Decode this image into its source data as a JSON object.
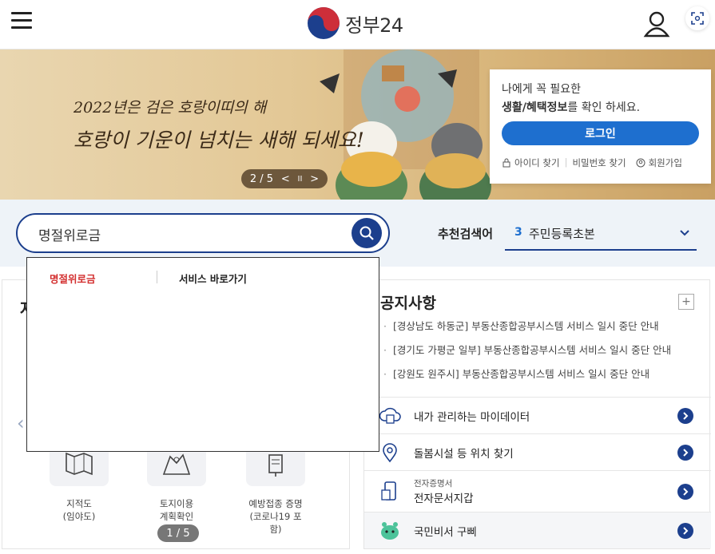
{
  "header": {
    "logo_text": "정부24"
  },
  "banner": {
    "line1": "2022년은 검은 호랑이띠의 해",
    "line2": "호랑이 기운이 넘치는 새해 되세요!",
    "slide_counter": "2 / 5",
    "prev": "<",
    "pause": "II",
    "next": ">"
  },
  "login_card": {
    "message_line1": "나에게 꼭 필요한",
    "message_bold": "생활/혜택정보",
    "message_rest": "를 확인 하세요.",
    "login_button": "로그인",
    "links": [
      "아이디 찾기",
      "비밀번호 찾기",
      "회원가입"
    ]
  },
  "search": {
    "value": "명절위로금",
    "recommended_label": "추천검색어",
    "recommended_rank": "3",
    "recommended_term": "주민등록초본"
  },
  "autocomplete": {
    "item": "명절위로금",
    "shortcut": "서비스 바로가기"
  },
  "left_panel": {
    "title_fragment": "자",
    "services": [
      {
        "label": "지적도\n(임야도)"
      },
      {
        "label": "토지이용\n계획확인"
      },
      {
        "label": "예방접종 증명\n(코로나19 포함)"
      }
    ],
    "page": "1 / 5"
  },
  "notices": {
    "title": "공지사항",
    "plus": "+",
    "items": [
      "[경상남도 하동군] 부동산종합공부시스템 서비스 일시 중단 안내",
      "[경기도 가평군 일부] 부동산종합공부시스템 서비스 일시 중단 안내",
      "[강원도 원주시] 부동산종합공부시스템 서비스 일시 중단 안내"
    ]
  },
  "quick_links": [
    {
      "text": "내가 관리하는 마이데이터",
      "icon": "cloud-data-icon"
    },
    {
      "text": "돌봄시설 등 위치 찾기",
      "icon": "location-pin-icon"
    },
    {
      "sub": "전자증명서",
      "text": "전자문서지갑",
      "icon": "phone-document-icon"
    },
    {
      "text": "국민비서 구삐",
      "icon": "mascot-icon"
    }
  ],
  "colors": {
    "primary": "#1c3f8d",
    "button_blue": "#1e6fcf",
    "highlight_red": "#d32f2f"
  }
}
